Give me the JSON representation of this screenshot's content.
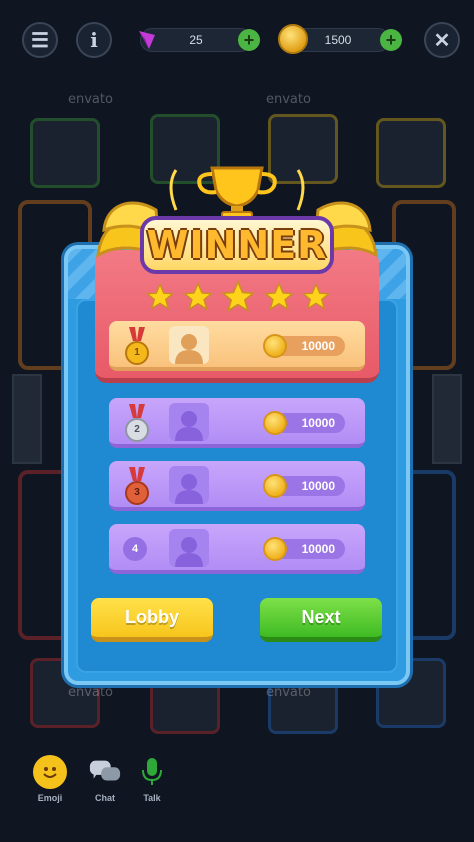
{
  "topbar": {
    "gems": "25",
    "coins": "1500"
  },
  "watermark": "envato",
  "winner_title": "WINNER",
  "stars_count": 5,
  "players": [
    {
      "rank": "1",
      "score": "10000",
      "medal": "gold"
    },
    {
      "rank": "2",
      "score": "10000",
      "medal": "silver"
    },
    {
      "rank": "3",
      "score": "10000",
      "medal": "bronze"
    },
    {
      "rank": "4",
      "score": "10000",
      "medal": "none"
    }
  ],
  "buttons": {
    "lobby": "Lobby",
    "next": "Next"
  },
  "bottom_bar": {
    "emoji": "Emoji",
    "chat": "Chat",
    "talk": "Talk"
  },
  "colors": {
    "lobby_button": "#f7c51c",
    "next_button": "#3fbb24",
    "panel_blue": "#2f9be0",
    "highlight_red": "#e85a68",
    "gold_row": "#f9c27c",
    "purple_row": "#b18df5"
  }
}
